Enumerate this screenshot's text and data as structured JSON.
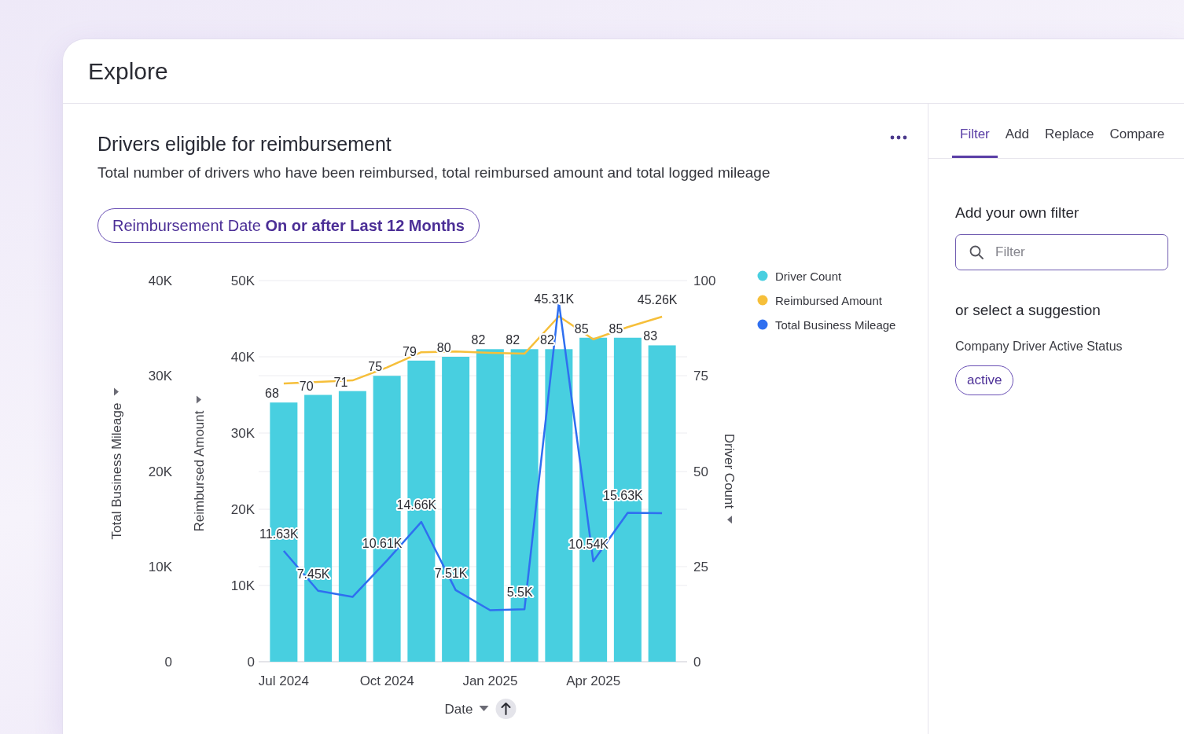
{
  "window": {
    "title": "Explore"
  },
  "card": {
    "title": "Drivers eligible for reimbursement",
    "subtitle": "Total number of drivers who have been reimbursed, total reimbursed amount and total logged mileage",
    "filter_chip": "Reimbursement Date **On or after Last 12 Months**",
    "chart_data": {
      "type": "bar",
      "xlabel": "Date",
      "categories": [
        "Jul 2024",
        null,
        null,
        "Oct 2024",
        null,
        null,
        "Jan 2025",
        null,
        null,
        "Apr 2025",
        null,
        null
      ],
      "ylabel": "Driver Count",
      "ylim": [
        0,
        100
      ],
      "yticks": [
        {
          "value": 0,
          "label": "0"
        },
        {
          "value": 25,
          "label": "25"
        },
        {
          "value": 50,
          "label": "50"
        },
        {
          "value": 75,
          "label": "75"
        },
        {
          "value": 100,
          "label": "100"
        }
      ],
      "y2label": "Reimbursed Amount",
      "y2lim": [
        0,
        50000
      ],
      "y2ticks": [
        {
          "value": 0,
          "label": "0"
        },
        {
          "value": 10000,
          "label": "10K"
        },
        {
          "value": 20000,
          "label": "20K"
        },
        {
          "value": 30000,
          "label": "30K"
        },
        {
          "value": 40000,
          "label": "40K"
        },
        {
          "value": 50000,
          "label": "50K"
        }
      ],
      "y3label": "Total Business Mileage",
      "y3lim": [
        0,
        40000
      ],
      "y3ticks": [
        {
          "value": 0,
          "label": "0"
        },
        {
          "value": 10000,
          "label": "10K"
        },
        {
          "value": 20000,
          "label": "20K"
        },
        {
          "value": 30000,
          "label": "30K"
        },
        {
          "value": 40000,
          "label": "40K"
        }
      ],
      "grid": true,
      "legend": "right",
      "series": [
        {
          "name": "Driver Count",
          "color": "#48cfe0",
          "values": [
            68,
            70,
            71,
            75,
            79,
            80,
            82,
            82,
            82,
            85,
            85,
            83
          ],
          "value_labels": [
            "68",
            "70",
            "71",
            "75",
            "79",
            "80",
            "82",
            "82",
            "82",
            "85",
            "85",
            "83"
          ]
        },
        {
          "name": "Reimbursed Amount",
          "type": "line",
          "axis": "y2",
          "color": "#f6bf3a",
          "values": [
            36500,
            36700,
            36900,
            38600,
            40600,
            40700,
            40500,
            40400,
            45310,
            42300,
            43900,
            45260
          ],
          "value_labels": [
            null,
            null,
            null,
            null,
            null,
            null,
            null,
            null,
            "45.31K",
            null,
            null,
            "45.26K"
          ]
        },
        {
          "name": "Total Business Mileage",
          "type": "line",
          "axis": "y3",
          "color": "#2f6ff0",
          "values": [
            11630,
            7450,
            6800,
            10610,
            14660,
            7510,
            5400,
            5500,
            37700,
            10540,
            15630,
            15600
          ],
          "value_labels": [
            "11.63K",
            "7.45K",
            null,
            "10.61K",
            "14.66K",
            "7.51K",
            null,
            "5.5K",
            null,
            "10.54K",
            "15.63K",
            null
          ]
        }
      ]
    }
  },
  "side_panel": {
    "tabs": [
      {
        "label": "Filter",
        "selected": true
      },
      {
        "label": "Add",
        "selected": false
      },
      {
        "label": "Replace",
        "selected": false
      },
      {
        "label": "Compare",
        "selected": false
      }
    ],
    "heading": "Add your own filter",
    "search": {
      "placeholder": "Filter"
    },
    "suggestions_heading": "or select a suggestion",
    "suggestion_groups": [
      {
        "label": "Company Driver Active Status",
        "values": [
          "active"
        ]
      }
    ]
  }
}
